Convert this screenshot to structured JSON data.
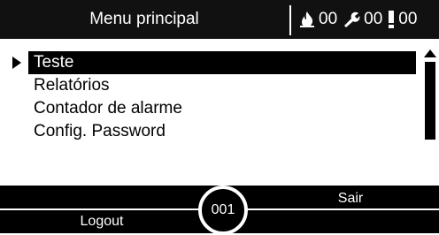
{
  "header": {
    "title": "Menu principal",
    "status": {
      "fire_icon": "fire-icon",
      "fire_count": "00",
      "wrench_icon": "wrench-icon",
      "fault_count": "00",
      "alert_icon": "exclamation-icon",
      "alert_count": "00"
    }
  },
  "menu": {
    "items": [
      {
        "label": "Teste",
        "selected": true
      },
      {
        "label": "Relatórios",
        "selected": false
      },
      {
        "label": "Contador de alarme",
        "selected": false
      },
      {
        "label": "Config. Password",
        "selected": false
      }
    ]
  },
  "footer": {
    "left_label": "Logout",
    "right_label": "Sair",
    "center_label": "001"
  }
}
